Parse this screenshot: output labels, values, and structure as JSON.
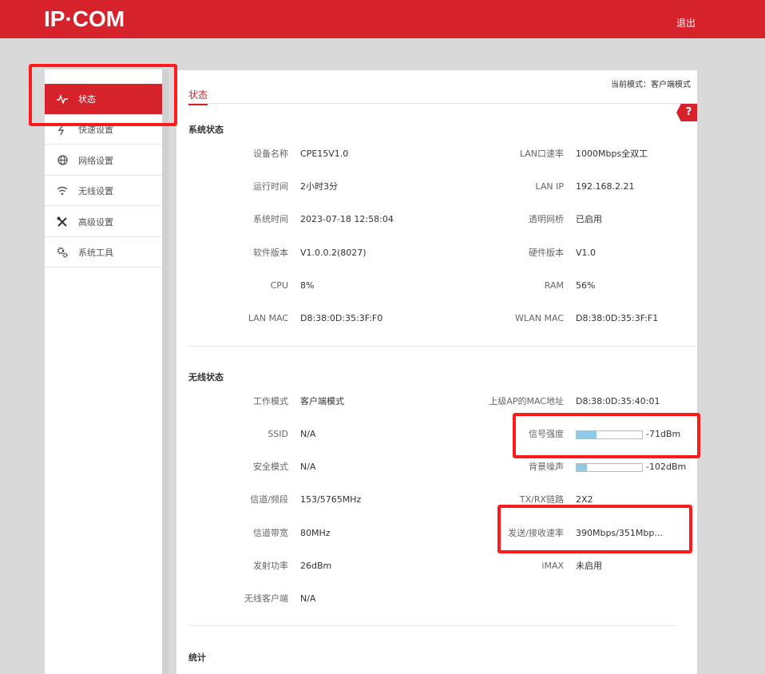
{
  "header": {
    "logo": "IP·COM",
    "logout": "退出"
  },
  "sidebar": {
    "items": [
      {
        "label": "状态",
        "icon": "pulse-icon",
        "active": true
      },
      {
        "label": "快速设置",
        "icon": "lightning-icon"
      },
      {
        "label": "网络设置",
        "icon": "globe-icon"
      },
      {
        "label": "无线设置",
        "icon": "wifi-icon"
      },
      {
        "label": "高级设置",
        "icon": "tools-icon"
      },
      {
        "label": "系统工具",
        "icon": "gears-icon"
      }
    ]
  },
  "main": {
    "current_mode": "当前模式：客户端模式",
    "tab": "状态",
    "help": "?",
    "system": {
      "title": "系统状态",
      "rows": [
        {
          "l_label": "设备名称",
          "l_value": "CPE15V1.0",
          "r_label": "LAN口速率",
          "r_value": "1000Mbps全双工"
        },
        {
          "l_label": "运行时间",
          "l_value": "2小时3分",
          "r_label": "LAN IP",
          "r_value": "192.168.2.21"
        },
        {
          "l_label": "系统时间",
          "l_value": "2023-07-18 12:58:04",
          "r_label": "透明网桥",
          "r_value": "已启用"
        },
        {
          "l_label": "软件版本",
          "l_value": "V1.0.0.2(8027)",
          "r_label": "硬件版本",
          "r_value": "V1.0"
        },
        {
          "l_label": "CPU",
          "l_value": "8%",
          "r_label": "RAM",
          "r_value": "56%"
        },
        {
          "l_label": "LAN MAC",
          "l_value": "D8:38:0D:35:3F:F0",
          "r_label": "WLAN MAC",
          "r_value": "D8:38:0D:35:3F:F1"
        }
      ]
    },
    "wireless": {
      "title": "无线状态",
      "rows": [
        {
          "l_label": "工作模式",
          "l_value": "客户端模式",
          "r_label": "上级AP的MAC地址",
          "r_value": "D8:38:0D:35:40:01"
        },
        {
          "l_label": "SSID",
          "l_value": "N/A",
          "r_label": "信号强度",
          "r_value": "-71dBm",
          "r_fill": 0.3
        },
        {
          "l_label": "安全模式",
          "l_value": "N/A",
          "r_label": "背景噪声",
          "r_value": "-102dBm",
          "r_fill": 0.16
        },
        {
          "l_label": "信道/频段",
          "l_value": "153/5765MHz",
          "r_label": "TX/RX链路",
          "r_value": "2X2"
        },
        {
          "l_label": "信道带宽",
          "l_value": "80MHz",
          "r_label": "发送/接收速率",
          "r_value": "390Mbps/351Mbp..."
        },
        {
          "l_label": "发射功率",
          "l_value": "26dBm",
          "r_label": "iMAX",
          "r_value": "未启用"
        },
        {
          "l_label": "无线客户端",
          "l_value": "N/A"
        }
      ]
    },
    "stats": {
      "title": "统计"
    }
  },
  "colors": {
    "brand": "#d6222b",
    "bar_fill": "#8fcbe6",
    "highlight": "#ff1b1b"
  }
}
